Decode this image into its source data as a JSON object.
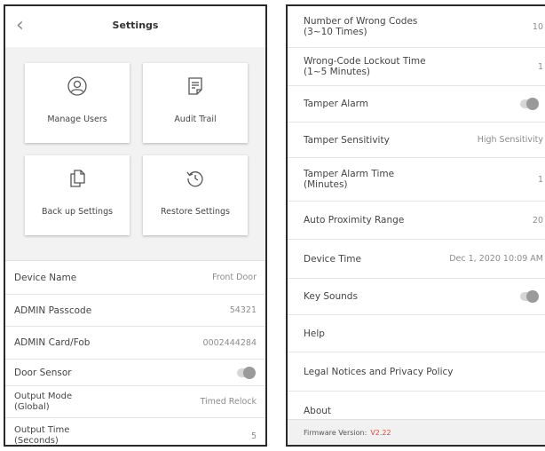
{
  "left_phone": {
    "header": {
      "back_icon": "chevron-left-icon",
      "title": "Settings"
    },
    "tiles": [
      {
        "label": "Manage Users",
        "icon": "user-icon"
      },
      {
        "label": "Audit Trail",
        "icon": "document-icon"
      },
      {
        "label": "Back up Settings",
        "icon": "copy-icon"
      },
      {
        "label": "Restore Settings",
        "icon": "history-icon"
      }
    ],
    "rows": {
      "device_name": {
        "label": "Device Name",
        "value": "Front Door"
      },
      "admin_passcode": {
        "label": "ADMIN Passcode",
        "value": "54321"
      },
      "admin_card": {
        "label": "ADMIN Card/Fob",
        "value": "0002444284"
      },
      "door_sensor": {
        "label": "Door Sensor",
        "toggle": "off"
      },
      "output_mode": {
        "label_line1": "Output Mode",
        "label_line2": "(Global)",
        "value": "Timed Relock"
      },
      "output_time": {
        "label_line1": "Output Time",
        "label_line2": "(Seconds)",
        "value": "5"
      }
    }
  },
  "right_phone": {
    "rows": {
      "wrong_codes": {
        "label_line1": "Number of Wrong Codes",
        "label_line2": "(3~10 Times)",
        "value": "10"
      },
      "lockout_time": {
        "label_line1": "Wrong-Code Lockout Time",
        "label_line2": "(1~5 Minutes)",
        "value": "1"
      },
      "tamper_alarm": {
        "label": "Tamper Alarm",
        "toggle": "off"
      },
      "tamper_sensitivity": {
        "label": "Tamper Sensitivity",
        "value": "High Sensitivity"
      },
      "tamper_alarm_time": {
        "label_line1": "Tamper Alarm Time",
        "label_line2": "(Minutes)",
        "value": "1"
      },
      "auto_proximity": {
        "label": "Auto Proximity Range",
        "value": "20"
      },
      "device_time": {
        "label": "Device Time",
        "value": "Dec 1, 2020 10:09 AM"
      },
      "key_sounds": {
        "label": "Key Sounds",
        "toggle": "off"
      },
      "help": {
        "label": "Help"
      },
      "legal": {
        "label": "Legal Notices and Privacy Policy"
      },
      "about": {
        "label": "About"
      }
    },
    "firmware": {
      "label": "Firmware Version:",
      "value": "V2.22"
    }
  },
  "colors": {
    "accent_firmware": "#e0483a",
    "tile_background": "#f2f2f2",
    "toggle_track": "#d6d6d6",
    "toggle_knob": "#9a9a9a"
  }
}
